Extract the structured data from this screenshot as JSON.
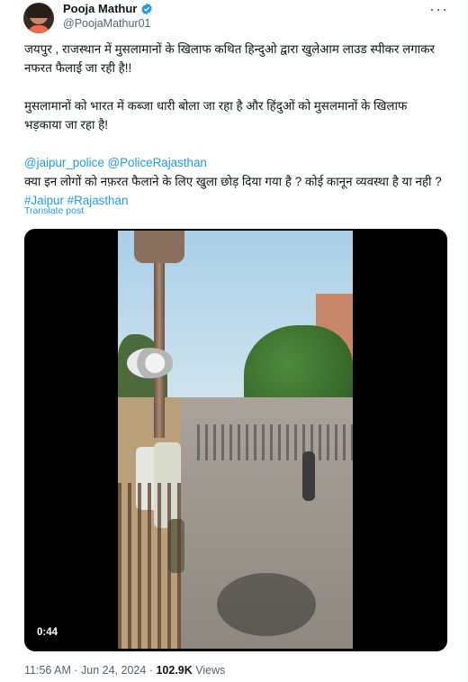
{
  "author": {
    "name": "Pooja Mathur",
    "handle": "@PoojaMathur01"
  },
  "more_icon": "more-icon",
  "tweet": {
    "line1": "जयपुर , राजस्थान में मुसलामानों के खिलाफ कथित हिन्दुओ द्वारा खुलेआम लाउड स्पीकर लगाकर नफरत फैलाई जा रही है!!",
    "line2": "मुसलामानों को भारत में कब्जा धारी बोला जा रहा है और हिंदुओं को मुसलमानों के खिलाफ भड़काया जा रहा है!",
    "mention1": "@jaipur_police",
    "mention2": "@PoliceRajasthan",
    "line3": "क्या इन लोगों को नफ़रत फैलाने के लिए खुला छोड़ दिया गया है ? कोई कानून व्यवस्था है या नही ?",
    "hashtag1": "#Jaipur",
    "hashtag2": "#Rajasthan"
  },
  "translate_label": "Translate post",
  "video": {
    "duration": "0:44"
  },
  "meta": {
    "time": "11:56 AM",
    "date": "Jun 24, 2024",
    "views_count": "102.9K",
    "views_label": "Views",
    "sep": "·"
  },
  "colors": {
    "link": "#1d9bf0",
    "muted": "#536471",
    "text": "#0f1419"
  }
}
